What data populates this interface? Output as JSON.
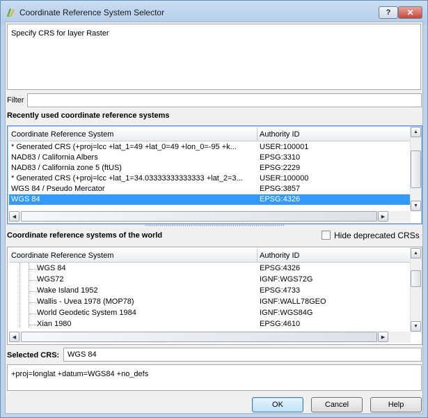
{
  "window": {
    "title": "Coordinate Reference System Selector",
    "help_label": "?",
    "close_label": "✕"
  },
  "message": "Specify CRS for layer Raster",
  "filter": {
    "label": "Filter",
    "value": ""
  },
  "recent": {
    "heading": "Recently used coordinate reference systems",
    "columns": [
      "Coordinate Reference System",
      "Authority ID"
    ],
    "rows": [
      {
        "crs": " * Generated CRS (+proj=lcc +lat_1=49 +lat_0=49 +lon_0=-95 +k...",
        "auth": "USER:100001",
        "selected": false
      },
      {
        "crs": "NAD83 / California Albers",
        "auth": "EPSG:3310",
        "selected": false
      },
      {
        "crs": "NAD83 / California zone 5 (ftUS)",
        "auth": "EPSG:2229",
        "selected": false
      },
      {
        "crs": " * Generated CRS (+proj=lcc +lat_1=34.03333333333333 +lat_2=3...",
        "auth": "USER:100000",
        "selected": false
      },
      {
        "crs": "WGS 84 / Pseudo Mercator",
        "auth": "EPSG:3857",
        "selected": false
      },
      {
        "crs": "WGS 84",
        "auth": "EPSG:4326",
        "selected": true
      }
    ]
  },
  "world": {
    "heading": "Coordinate reference systems of the world",
    "hide_deprecated_label": "Hide deprecated CRSs",
    "hide_deprecated_checked": false,
    "columns": [
      "Coordinate Reference System",
      "Authority ID"
    ],
    "rows": [
      {
        "crs": "WGS 84",
        "auth": "EPSG:4326"
      },
      {
        "crs": "WGS72",
        "auth": "IGNF:WGS72G"
      },
      {
        "crs": "Wake Island 1952",
        "auth": "EPSG:4733"
      },
      {
        "crs": "Wallis - Uvea 1978 (MOP78)",
        "auth": "IGNF:WALL78GEO"
      },
      {
        "crs": "World Geodetic System 1984",
        "auth": "IGNF:WGS84G"
      },
      {
        "crs": "Xian 1980",
        "auth": "EPSG:4610"
      }
    ]
  },
  "selected_crs": {
    "label": "Selected CRS:",
    "value": "WGS 84"
  },
  "proj_string": "+proj=longlat +datum=WGS84 +no_defs",
  "buttons": {
    "ok": "OK",
    "cancel": "Cancel",
    "help": "Help"
  },
  "scroll_arrows": {
    "up": "▲",
    "down": "▼",
    "left": "◀",
    "right": "▶"
  },
  "icons": {
    "app": "qgis-logo-icon"
  }
}
